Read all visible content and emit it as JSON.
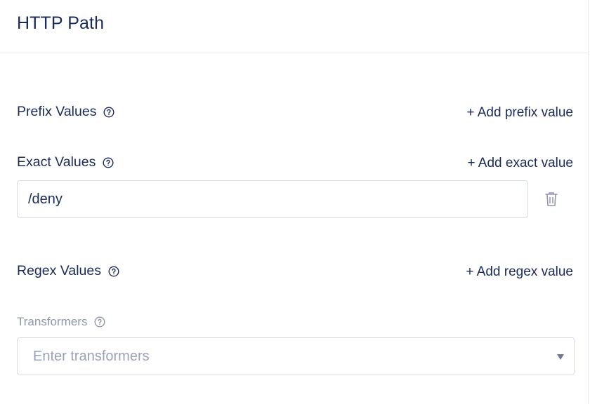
{
  "header": {
    "title": "HTTP Path"
  },
  "prefix": {
    "label": "Prefix Values",
    "help_icon": "question-circle-icon",
    "add_label": "+ Add prefix value"
  },
  "exact": {
    "label": "Exact Values",
    "help_icon": "question-circle-icon",
    "add_label": "+ Add exact value",
    "values": [
      "/deny"
    ],
    "delete_icon": "trash-icon"
  },
  "regex": {
    "label": "Regex Values",
    "help_icon": "question-circle-icon",
    "add_label": "+ Add regex value"
  },
  "transformers": {
    "label": "Transformers",
    "help_icon": "question-circle-icon",
    "placeholder": "Enter transformers",
    "caret_icon": "caret-down-icon"
  },
  "colors": {
    "text": "#1b2a5a",
    "muted": "#8f97ad",
    "border": "#d6dbe8"
  }
}
